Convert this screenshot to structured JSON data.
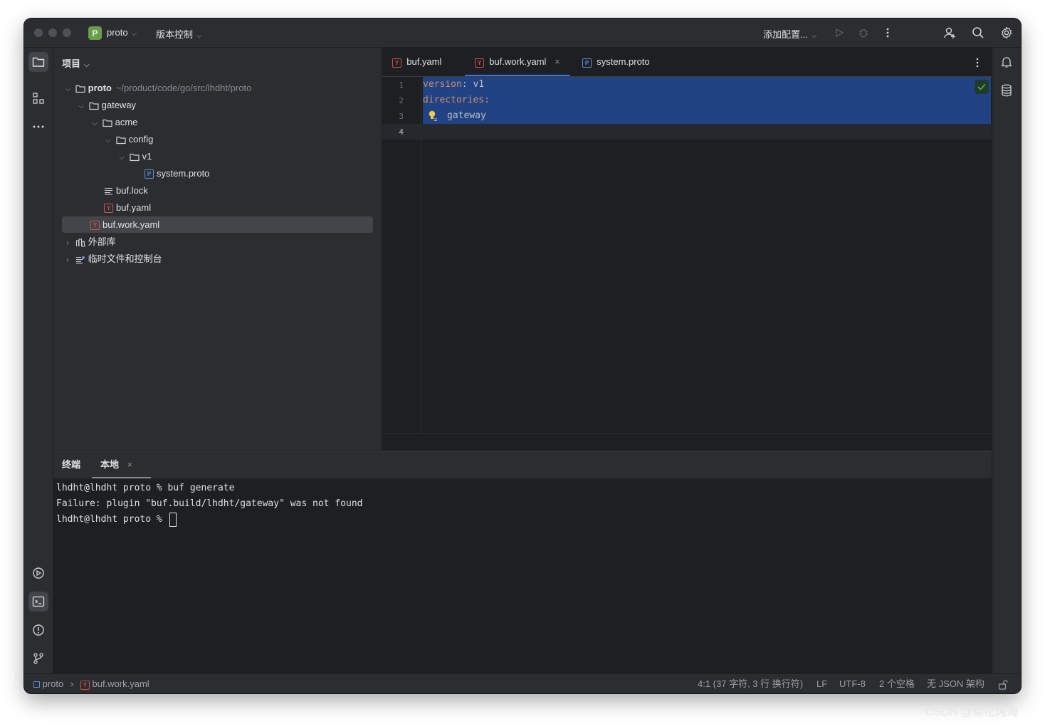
{
  "titlebar": {
    "project_badge": "P",
    "project_name": "proto",
    "vcs_label": "版本控制",
    "run_config_label": "添加配置..."
  },
  "project_panel": {
    "title": "项目",
    "tree": [
      {
        "label": "proto",
        "hint": "~/product/code/go/src/lhdht/proto"
      },
      {
        "label": "gateway"
      },
      {
        "label": "acme"
      },
      {
        "label": "config"
      },
      {
        "label": "v1"
      },
      {
        "label": "system.proto"
      },
      {
        "label": "buf.lock"
      },
      {
        "label": "buf.yaml"
      },
      {
        "label": "buf.work.yaml"
      },
      {
        "label": "外部库"
      },
      {
        "label": "临时文件和控制台"
      }
    ]
  },
  "editor": {
    "tabs": [
      {
        "label": "buf.yaml"
      },
      {
        "label": "buf.work.yaml"
      },
      {
        "label": "system.proto"
      }
    ],
    "line_numbers": [
      "1",
      "2",
      "3",
      "4"
    ],
    "lines": [
      {
        "key": "version",
        "sep": ": ",
        "value": "v1"
      },
      {
        "key": "directories",
        "sep": ":",
        "value": ""
      },
      {
        "key": "",
        "sep": "",
        "value": "gateway"
      }
    ]
  },
  "terminal": {
    "tabs": [
      {
        "label": "终端"
      },
      {
        "label": "本地"
      }
    ],
    "lines": [
      "lhdht@lhdht proto % buf generate",
      "Failure: plugin \"buf.build/lhdht/gateway\" was not found",
      "lhdht@lhdht proto % "
    ]
  },
  "statusbar": {
    "breadcrumb_root": "proto",
    "breadcrumb_file": "buf.work.yaml",
    "position": "4:1 (37 字符, 3 行 换行符)",
    "line_ending": "LF",
    "encoding": "UTF-8",
    "indent": "2 个空格",
    "schema": "无 JSON 架构"
  },
  "watermark": "CSDN @梨花炖海",
  "colors": {
    "accent": "#3574f0",
    "selection": "#214283",
    "yaml_key": "#cf8e6d",
    "yaml_icon": "#c94f4f",
    "proto_icon": "#5e8ed6"
  }
}
